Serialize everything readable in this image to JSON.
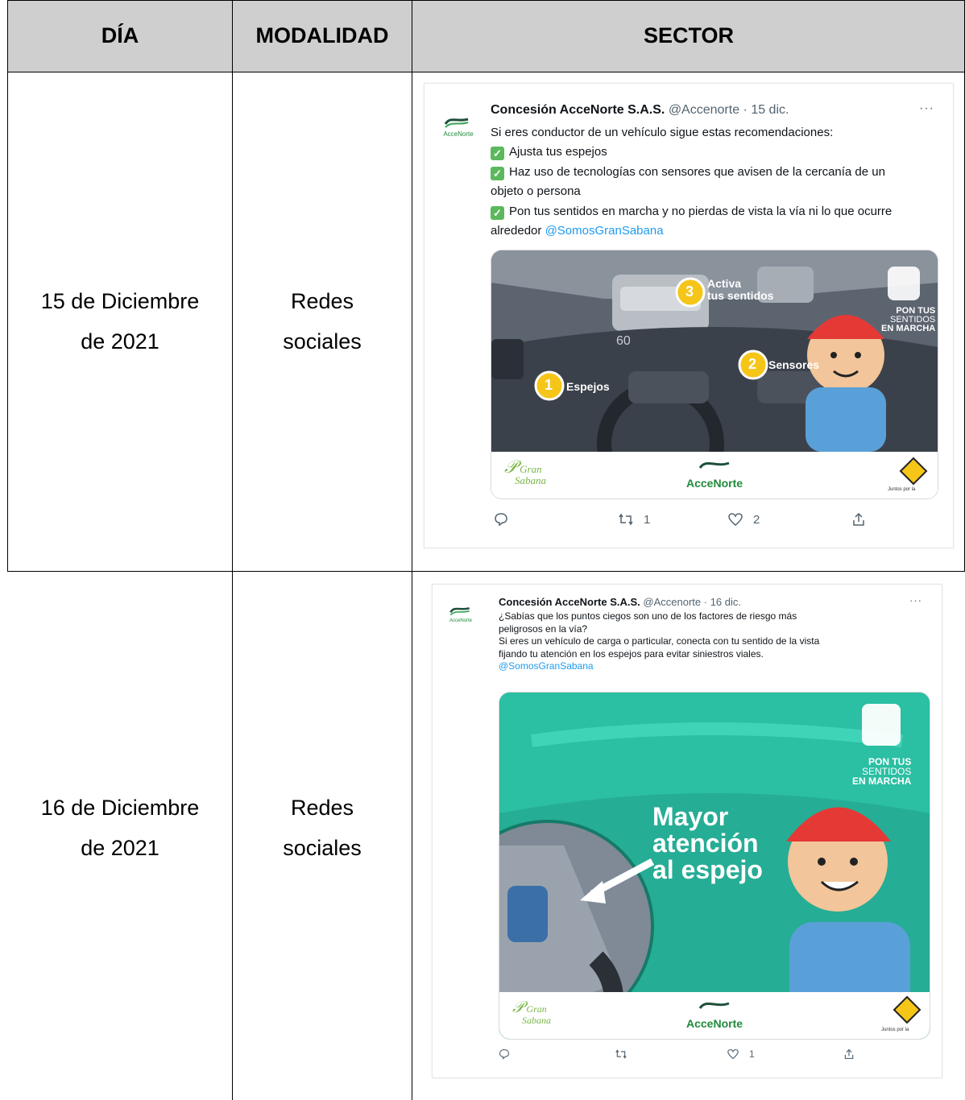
{
  "table": {
    "headers": {
      "dia": "DÍA",
      "modalidad": "MODALIDAD",
      "sector": "SECTOR"
    },
    "rows": [
      {
        "dia_line1": "15 de Diciembre",
        "dia_line2": "de 2021",
        "modalidad_line1": "Redes",
        "modalidad_line2": "sociales"
      },
      {
        "dia_line1": "16 de Diciembre",
        "dia_line2": "de 2021",
        "modalidad_line1": "Redes",
        "modalidad_line2": "sociales"
      }
    ]
  },
  "tweets": [
    {
      "account_name": "Concesión AcceNorte S.A.S.",
      "handle_date": "@Accenorte · 15 dic.",
      "more": "···",
      "avatar_label": "AcceNorte",
      "body": [
        "Si eres conductor de un vehículo sigue estas recomendaciones:",
        "Ajusta tus espejos",
        "Haz uso de tecnologías con sensores que avisen de la cercanía de un",
        "objeto o persona",
        "Pon tus sentidos en marcha y no pierdas de vista la vía ni lo que ocurre",
        "alrededor"
      ],
      "mention": "@SomosGranSabana",
      "image": {
        "num1": "1",
        "label1": "Espejos",
        "num2": "2",
        "label2": "Sensores",
        "num3": "3",
        "label3a": "Activa",
        "label3b": "tus sentidos",
        "speed": "60",
        "campaign_1": "PON TUS",
        "campaign_2": "SENTIDOS",
        "campaign_3": "EN MARCHA",
        "gran_1": "Gran",
        "gran_2": "Sabana",
        "acce_logo": "AcceNorte",
        "sign_text": "Juntos por la"
      },
      "actions": {
        "retweets": "1",
        "likes": "2"
      }
    },
    {
      "account_name": "Concesión AcceNorte S.A.S.",
      "handle_date": "@Accenorte · 16 dic.",
      "more": "···",
      "avatar_label": "AcceNorte",
      "body": [
        "¿Sabías que los puntos ciegos son uno de los factores de riesgo más",
        "peligrosos en la vía?",
        "Si eres un vehículo de carga o particular, conecta con tu sentido de la vista",
        "fijando tu atención en los espejos para evitar siniestros viales."
      ],
      "mention": "@SomosGranSabana",
      "image": {
        "headline_1": "Mayor",
        "headline_2": "atención",
        "headline_3": "al espejo",
        "campaign_1": "PON TUS",
        "campaign_2": "SENTIDOS",
        "campaign_3": "EN MARCHA",
        "gran_1": "Gran",
        "gran_2": "Sabana",
        "acce_logo": "AcceNorte",
        "sign_text": "Juntos por la"
      },
      "actions": {
        "retweets": "",
        "likes": "1"
      }
    }
  ],
  "colors": {
    "header_bg": "#cfcfcf",
    "mention": "#1d9bf0",
    "accent_yellow": "#f5c518",
    "teal": "#2bbfa3"
  }
}
